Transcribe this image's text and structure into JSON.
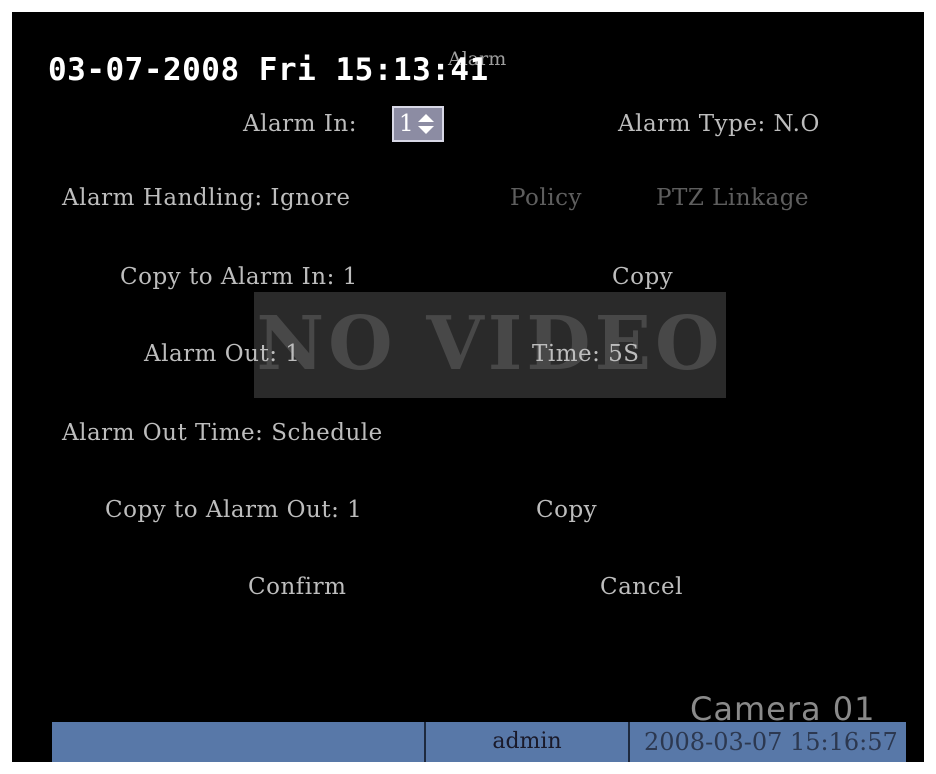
{
  "menu": {
    "title": "Alarm",
    "alarm_in_label": "Alarm In:",
    "alarm_in_value": "1",
    "alarm_type": "Alarm Type: N.O",
    "alarm_handling": "Alarm Handling: Ignore",
    "policy": "Policy",
    "ptz_linkage": "PTZ Linkage",
    "copy_to_alarm_in": "Copy to Alarm In: 1",
    "copy_in_button": "Copy",
    "alarm_out": "Alarm Out: 1",
    "time": "Time: 5S",
    "alarm_out_time": "Alarm Out Time: Schedule",
    "copy_to_alarm_out": "Copy to Alarm Out: 1",
    "copy_out_button": "Copy",
    "confirm": "Confirm",
    "cancel": "Cancel"
  },
  "overlay": {
    "datetime": "03-07-2008 Fri 15:13:41",
    "no_video": "NO VIDEO",
    "camera": "Camera 01"
  },
  "statusbar": {
    "user": "admin",
    "clock": "2008-03-07 15:16:57"
  },
  "colors": {
    "background": "#000000",
    "menu_text": "#bdbdbd",
    "disabled_text": "#5e5e5e",
    "status_bar": "#5878a8",
    "spinner": "#8c8ca3"
  },
  "icons": [
    "up-down-arrow-icon"
  ]
}
